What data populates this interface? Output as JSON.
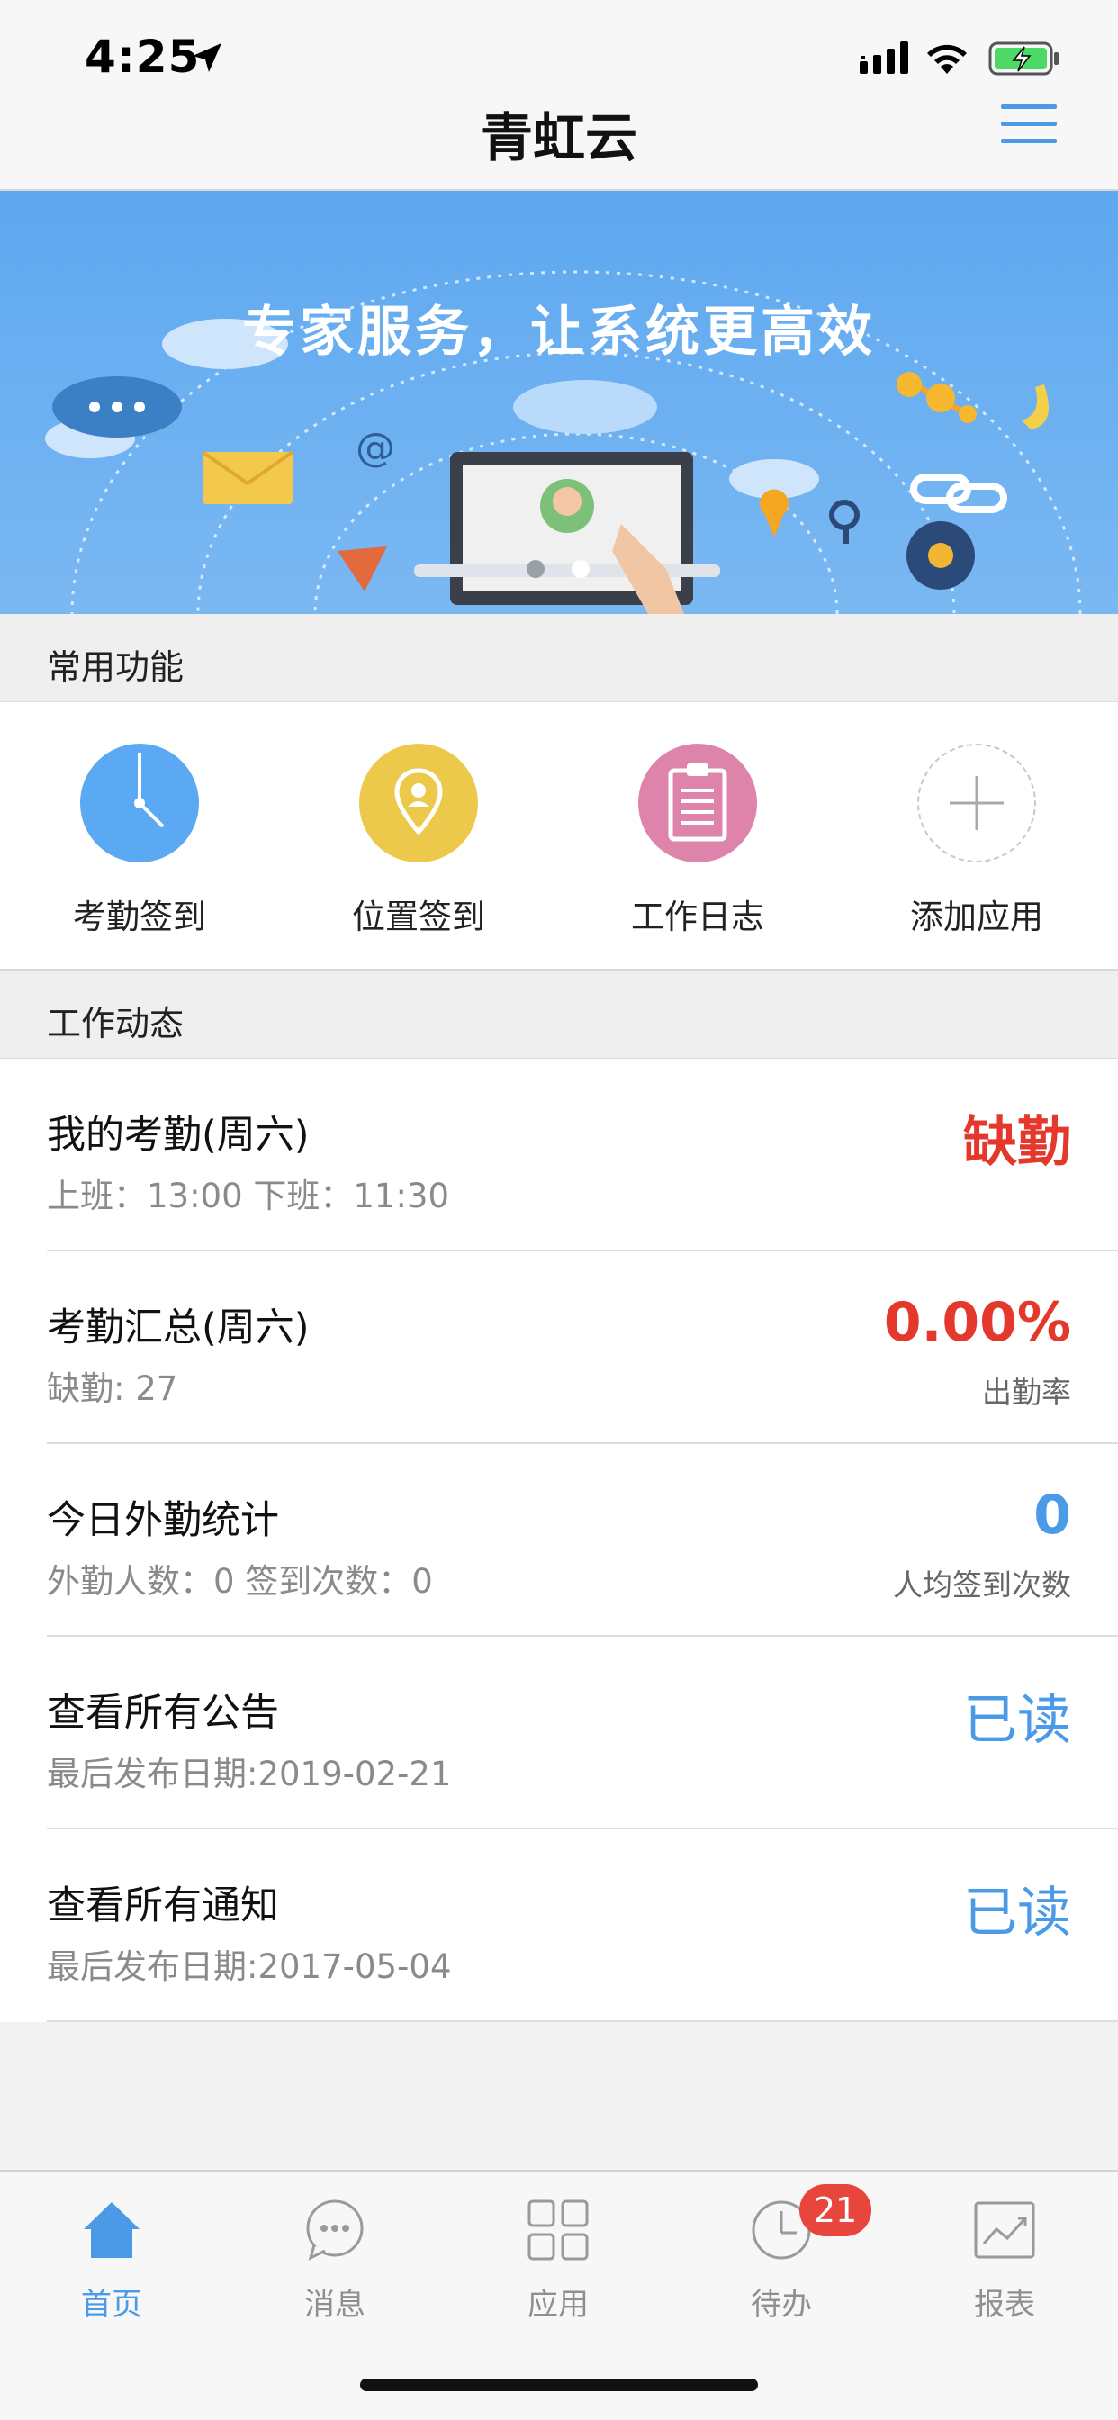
{
  "status_bar": {
    "time": "4:25"
  },
  "nav": {
    "title": "青虹云"
  },
  "banner": {
    "slogan": "专家服务，让系统更高效"
  },
  "quick_section": {
    "title": "常用功能",
    "items": [
      {
        "label": "考勤签到",
        "icon": "clock-icon",
        "color": "#5aa9f2"
      },
      {
        "label": "位置签到",
        "icon": "location-pin-icon",
        "color": "#ecc94b"
      },
      {
        "label": "工作日志",
        "icon": "clipboard-icon",
        "color": "#de84ab"
      },
      {
        "label": "添加应用",
        "icon": "plus-icon",
        "color": "#cccccc"
      }
    ]
  },
  "feed_section": {
    "title": "工作动态",
    "rows": [
      {
        "title": "我的考勤(周六)",
        "subtitle": "上班：13:00 下班：11:30",
        "value": "缺勤",
        "value_caption": ""
      },
      {
        "title": "考勤汇总(周六)",
        "subtitle": "缺勤: 27",
        "value": "0.00%",
        "value_caption": "出勤率"
      },
      {
        "title": "今日外勤统计",
        "subtitle": "外勤人数：0 签到次数：0",
        "value": "0",
        "value_caption": "人均签到次数"
      },
      {
        "title": "查看所有公告",
        "subtitle": "最后发布日期:2019-02-21",
        "value": "已读",
        "value_caption": ""
      },
      {
        "title": "查看所有通知",
        "subtitle": "最后发布日期:2017-05-04",
        "value": "已读",
        "value_caption": ""
      }
    ]
  },
  "tab_bar": {
    "tabs": [
      {
        "label": "首页",
        "icon": "home-icon",
        "active": true
      },
      {
        "label": "消息",
        "icon": "chat-bubble-icon",
        "active": false
      },
      {
        "label": "应用",
        "icon": "apps-grid-icon",
        "active": false
      },
      {
        "label": "待办",
        "icon": "clock-icon",
        "active": false
      },
      {
        "label": "报表",
        "icon": "chart-icon",
        "active": false
      }
    ],
    "todo_badge": "21"
  },
  "colors": {
    "accent": "#4a9ae8",
    "alert": "#e3382b",
    "banner": "#6aaef0"
  }
}
